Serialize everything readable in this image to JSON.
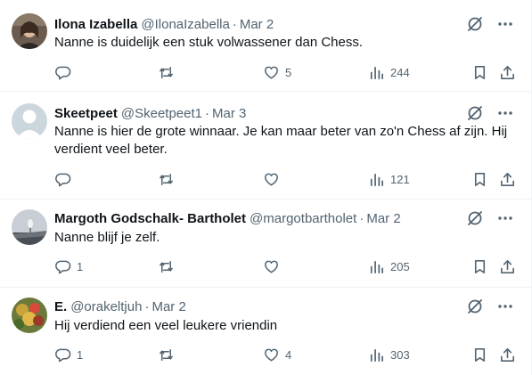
{
  "tweets": [
    {
      "name": "Ilona Izabella",
      "handle": "@IlonaIzabella",
      "date": "Mar 2",
      "text": "Nanne is duidelijk een stuk volwassener dan Chess.",
      "replies": "",
      "retweets": "",
      "likes": "5",
      "views": "244"
    },
    {
      "name": "Skeetpeet",
      "handle": "@Skeetpeet1",
      "date": "Mar 3",
      "text": "Nanne is hier de grote winnaar. Je kan maar beter van zo'n Chess af zijn. Hij verdient veel beter.",
      "replies": "",
      "retweets": "",
      "likes": "",
      "views": "121"
    },
    {
      "name": "Margoth Godschalk- Bartholet",
      "handle": "@margotbartholet",
      "date": "Mar 2",
      "text": "Nanne blijf je zelf.",
      "replies": "1",
      "retweets": "",
      "likes": "",
      "views": "205"
    },
    {
      "name": "E.",
      "handle": "@orakeltjuh",
      "date": "Mar 2",
      "text": "Hij verdiend een veel leukere vriendin",
      "replies": "1",
      "retweets": "",
      "likes": "4",
      "views": "303"
    }
  ],
  "separator": "·",
  "icons": {
    "grok": "grok-slash-circle-icon",
    "more": "more-dots-icon",
    "reply": "reply-bubble-icon",
    "retweet": "retweet-arrows-icon",
    "like": "heart-icon",
    "views": "views-bar-chart-icon",
    "bookmark": "bookmark-icon",
    "share": "share-upload-icon"
  },
  "colors": {
    "text": "#0f1419",
    "muted": "#536471",
    "divider": "#eff3f4"
  }
}
